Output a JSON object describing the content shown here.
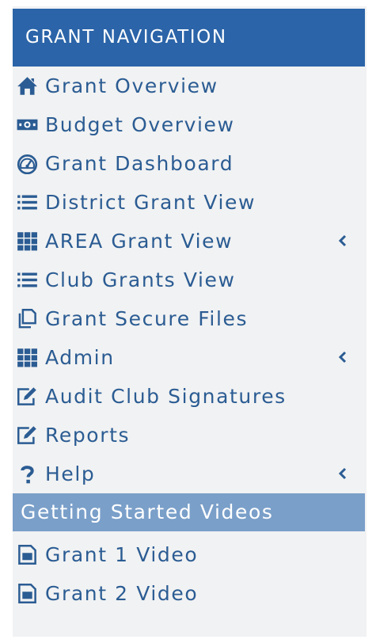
{
  "header": {
    "title": "GRANT NAVIGATION"
  },
  "colors": {
    "header_bg": "#2b64a8",
    "section_bg": "#7a9fc9",
    "link": "#2b5c93",
    "panel_bg": "#f1f2f3"
  },
  "nav": {
    "items": [
      {
        "label": "Grant Overview",
        "icon": "home-icon"
      },
      {
        "label": "Budget Overview",
        "icon": "money-icon"
      },
      {
        "label": "Grant Dashboard",
        "icon": "dashboard-icon"
      },
      {
        "label": "District Grant View",
        "icon": "list-icon"
      },
      {
        "label": "AREA Grant View",
        "icon": "grid-icon",
        "expandable": true
      },
      {
        "label": "Club Grants View",
        "icon": "list-icon"
      },
      {
        "label": "Grant Secure Files",
        "icon": "copy-icon"
      },
      {
        "label": "Admin",
        "icon": "grid-icon",
        "expandable": true
      },
      {
        "label": "Audit Club Signatures",
        "icon": "edit-icon"
      },
      {
        "label": "Reports",
        "icon": "edit-icon"
      },
      {
        "label": "Help",
        "icon": "question-icon",
        "expandable": true
      }
    ]
  },
  "videos": {
    "section_title": "Getting Started Videos",
    "items": [
      {
        "label": "Grant 1 Video",
        "icon": "file-icon"
      },
      {
        "label": "Grant 2 Video",
        "icon": "file-icon"
      }
    ]
  }
}
